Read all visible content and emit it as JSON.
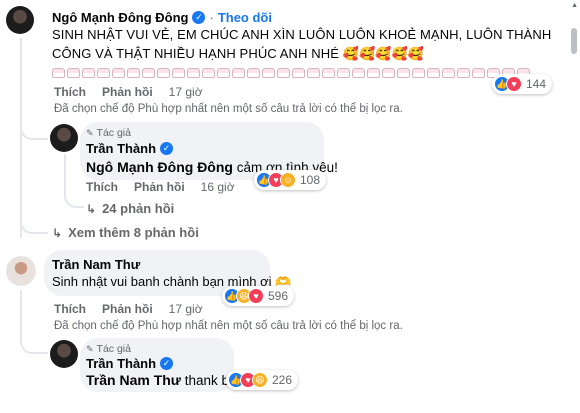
{
  "comment1": {
    "author": "Ngô Mạnh Đông Đông",
    "follow": "Theo dõi",
    "text_line1": "SINH NHẬT VUI VẺ, EM CHÚC ANH XÌN LUÔN LUÔN KHOẺ MẠNH, LUÔN THÀNH",
    "text_line2": "CÔNG VÀ THẬT NHIỀU HẠNH PHÚC ANH NHÉ 🥰🥰🥰🥰🥰",
    "reactions_count": "144",
    "like": "Thích",
    "reply": "Phản hồi",
    "time": "17 giờ",
    "notice": "Đã chọn chế độ Phù hợp nhất nên một số câu trả lời có thể bị lọc ra."
  },
  "reply1": {
    "author_tag": "Tác giả",
    "author": "Trần Thành",
    "mention": "Ngô Mạnh Đông Đông",
    "text": " cảm ơn tình yêu!",
    "reactions_count": "108",
    "like": "Thích",
    "reply": "Phản hồi",
    "time": "16 giờ",
    "replies_link": "24 phản hồi"
  },
  "more_replies": "Xem thêm 8 phản hồi",
  "comment2": {
    "author": "Trần Nam Thư",
    "text": "Sinh nhật vui banh chành bạn mình ơi 🫶",
    "reactions_count": "596",
    "like": "Thích",
    "reply": "Phản hồi",
    "time": "17 giờ",
    "notice": "Đã chọn chế độ Phù hợp nhất nên một số câu trả lời có thể bị lọc ra."
  },
  "reply2": {
    "author_tag": "Tác giả",
    "author": "Trần Thành",
    "mention": "Trần Nam Thư",
    "text": " thank bồ",
    "reactions_count": "226"
  },
  "colors": {
    "accent": "#1877f2",
    "bubble": "#f0f2f5",
    "muted": "#65676b"
  }
}
